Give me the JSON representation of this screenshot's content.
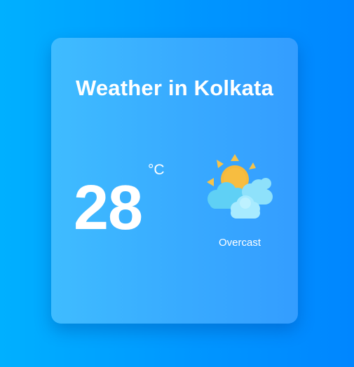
{
  "card": {
    "title": "Weather in Kolkata",
    "temperature": "28",
    "unit": "°C",
    "condition": "Overcast",
    "condition_icon": "partly-cloudy-sun-icon"
  },
  "colors": {
    "background_start": "#00b0ff",
    "background_end": "#0086ff",
    "card_start": "#3fbcff",
    "card_end": "#349dff",
    "sun": "#f6b93b",
    "cloud_light": "#9be6ff",
    "cloud_dark": "#5fd0f5"
  }
}
